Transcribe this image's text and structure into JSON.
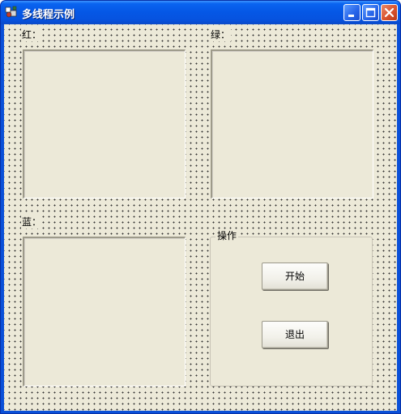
{
  "window": {
    "title": "多线程示例",
    "title_bar_color": "#0a64f0",
    "client_color": "#ece9d8",
    "controls": [
      "minimize-icon",
      "maximize-icon",
      "close-icon"
    ]
  },
  "panels": {
    "red_label": "红：",
    "green_label": "绿：",
    "blue_label": "蓝："
  },
  "operations": {
    "group_title": "操作",
    "start_label": "开始",
    "exit_label": "退出"
  }
}
